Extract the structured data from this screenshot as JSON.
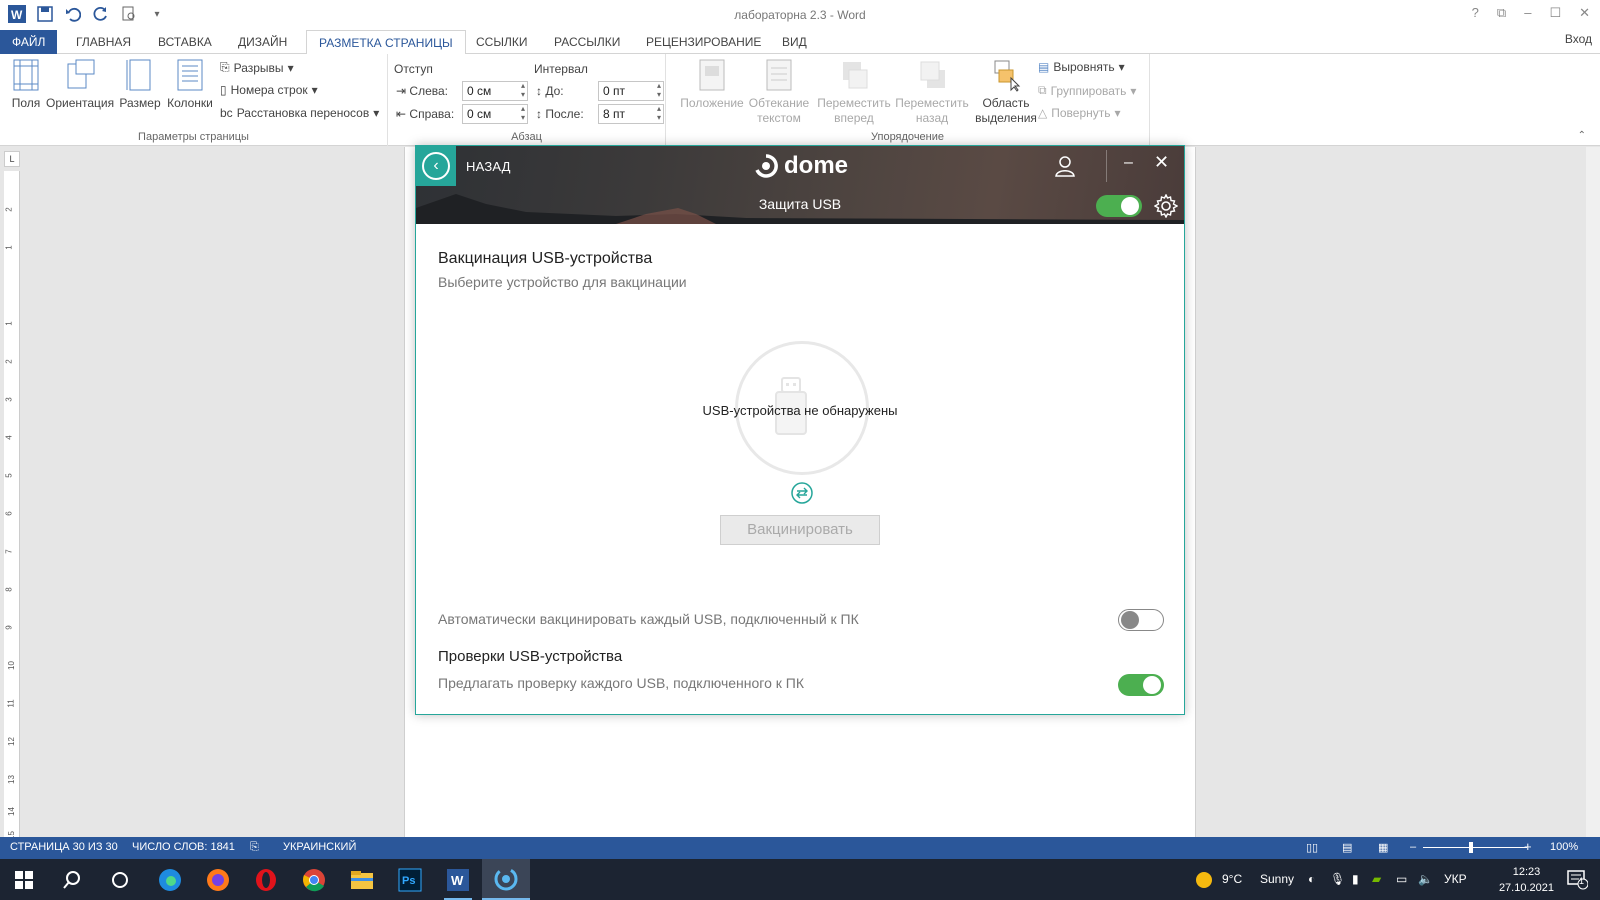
{
  "word": {
    "title": "лабораторна 2.3 - Word",
    "window_controls": [
      "?",
      "⧉",
      "–",
      "☐",
      "✕"
    ],
    "login": "Вход",
    "tabs": [
      "ФАЙЛ",
      "ГЛАВНАЯ",
      "ВСТАВКА",
      "ДИЗАЙН",
      "РАЗМЕТКА СТРАНИЦЫ",
      "ССЫЛКИ",
      "РАССЫЛКИ",
      "РЕЦЕНЗИРОВАНИЕ",
      "ВИД"
    ],
    "active_tab": "РАЗМЕТКА СТРАНИЦЫ",
    "ribbon": {
      "page_setup": {
        "label": "Параметры страницы",
        "margins": "Поля",
        "orientation": "Ориентация",
        "size": "Размер",
        "columns": "Колонки",
        "breaks": "Разрывы",
        "line_numbers": "Номера строк",
        "hyphenation": "Расстановка переносов"
      },
      "paragraph": {
        "label": "Абзац",
        "indent": "Отступ",
        "left": "Слева:",
        "right": "Справа:",
        "left_value": "0 см",
        "right_value": "0 см",
        "spacing": "Интервал",
        "before": "До:",
        "after": "После:",
        "before_value": "0 пт",
        "after_value": "8 пт"
      },
      "arrange": {
        "label": "Упорядочение",
        "position": "Положение",
        "wrap_1": "Обтекание",
        "wrap_2": "текстом",
        "forward_1": "Переместить",
        "forward_2": "вперед",
        "backward_1": "Переместить",
        "backward_2": "назад",
        "selection_1": "Область",
        "selection_2": "выделения",
        "align": "Выровнять",
        "group": "Группировать",
        "rotate": "Повернуть"
      }
    },
    "ruler_corner": "L",
    "ruler_numbers": [
      "2",
      "1",
      "1",
      "2",
      "3",
      "4",
      "5",
      "6",
      "7",
      "8",
      "9",
      "10",
      "11",
      "12",
      "13",
      "14",
      "15"
    ],
    "status": {
      "page": "СТРАНИЦА 30 ИЗ 30",
      "words": "ЧИСЛО СЛОВ: 1841",
      "language": "УКРАИНСКИЙ",
      "zoom": "100%"
    }
  },
  "dome": {
    "back": "НАЗАД",
    "logo": "dome",
    "subtitle": "Защита USB",
    "protection_enabled": true,
    "vaccination_title": "Вакцинация USB-устройства",
    "vaccination_subtitle": "Выберите устройство для вакцинации",
    "no_devices": "USB-устройства не обнаружены",
    "vaccinate_button": "Вакцинировать",
    "auto_vaccinate_label": "Автоматически вакцинировать каждый USB, подключенный к ПК",
    "auto_vaccinate_enabled": false,
    "checks_title": "Проверки USB-устройства",
    "checks_subtitle": "Предлагать проверку каждого USB, подключенного к ПК",
    "checks_enabled": true,
    "accent_color": "#26a69a",
    "toggle_on_color": "#4caf50"
  },
  "taskbar": {
    "apps": [
      "start-icon",
      "search-icon",
      "task-view-icon",
      "edge-icon",
      "firefox-icon",
      "opera-icon",
      "chrome-icon",
      "explorer-icon",
      "photoshop-icon",
      "word-icon",
      "dome-icon"
    ],
    "weather_temp": "9°C",
    "weather_text": "Sunny",
    "language": "УКР",
    "time": "12:23",
    "date": "27.10.2021",
    "notifications": "1"
  }
}
